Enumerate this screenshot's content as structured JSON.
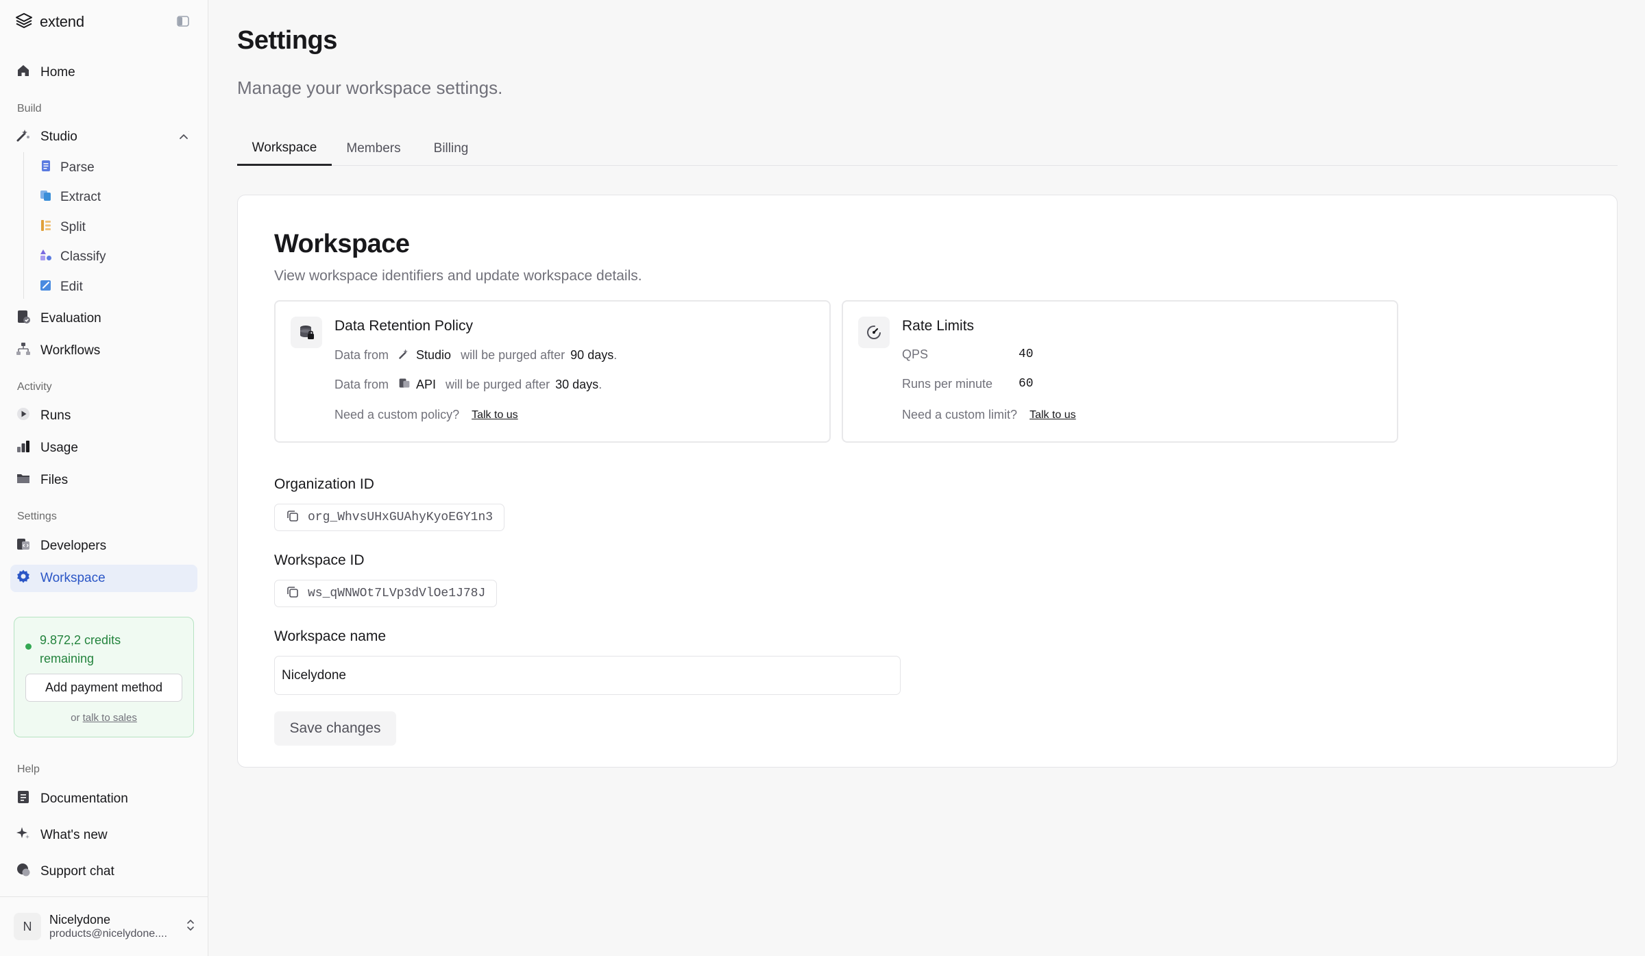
{
  "brand": {
    "name": "extend"
  },
  "sidebar": {
    "home": "Home",
    "sections": {
      "build": "Build",
      "activity": "Activity",
      "settings": "Settings",
      "help": "Help"
    },
    "studio": {
      "label": "Studio",
      "children": [
        {
          "label": "Parse",
          "icon": "parse-icon",
          "color": "#5b7be0"
        },
        {
          "label": "Extract",
          "icon": "extract-icon",
          "color": "#3b8ed8"
        },
        {
          "label": "Split",
          "icon": "split-icon",
          "color": "#e0a03b"
        },
        {
          "label": "Classify",
          "icon": "classify-icon",
          "color": "#7a6be0"
        },
        {
          "label": "Edit",
          "icon": "edit-icon",
          "color": "#4a8be0"
        }
      ]
    },
    "evaluation": "Evaluation",
    "workflows": "Workflows",
    "runs": "Runs",
    "usage": "Usage",
    "files": "Files",
    "developers": "Developers",
    "workspace": "Workspace",
    "documentation": "Documentation",
    "whats_new": "What's new",
    "support_chat": "Support chat",
    "credits": {
      "text": "9.872,2 credits remaining",
      "button": "Add payment method",
      "or": "or",
      "sales_link": "talk to sales",
      "color": "#23833d"
    },
    "user": {
      "initial": "N",
      "name": "Nicelydone",
      "email": "products@nicelydone...."
    }
  },
  "header": {
    "title": "Settings",
    "subtitle": "Manage your workspace settings."
  },
  "tabs": [
    {
      "label": "Workspace",
      "active": true
    },
    {
      "label": "Members",
      "active": false
    },
    {
      "label": "Billing",
      "active": false
    }
  ],
  "workspace_card": {
    "title": "Workspace",
    "description": "View workspace identifiers and update workspace details.",
    "retention": {
      "title": "Data Retention Policy",
      "line1": {
        "prefix": "Data from",
        "source": "Studio",
        "middle": "will be purged after",
        "days": "90 days",
        "suffix": "."
      },
      "line2": {
        "prefix": "Data from",
        "source": "API",
        "middle": "will be purged after",
        "days": "30 days",
        "suffix": "."
      },
      "custom": "Need a custom policy?",
      "link": "Talk to us"
    },
    "rate_limits": {
      "title": "Rate Limits",
      "rows": [
        {
          "label": "QPS",
          "value": "40"
        },
        {
          "label": "Runs per minute",
          "value": "60"
        }
      ],
      "custom": "Need a custom limit?",
      "link": "Talk to us"
    },
    "org_id": {
      "label": "Organization ID",
      "value": "org_WhvsUHxGUAhyKyoEGY1n3"
    },
    "workspace_id": {
      "label": "Workspace ID",
      "value": "ws_qWNWOt7LVp3dVlOe1J78J"
    },
    "workspace_name": {
      "label": "Workspace name",
      "value": "Nicelydone"
    },
    "save": "Save changes"
  },
  "colors": {
    "accent": "#2b56c6",
    "active_bg": "#e9eef9"
  }
}
